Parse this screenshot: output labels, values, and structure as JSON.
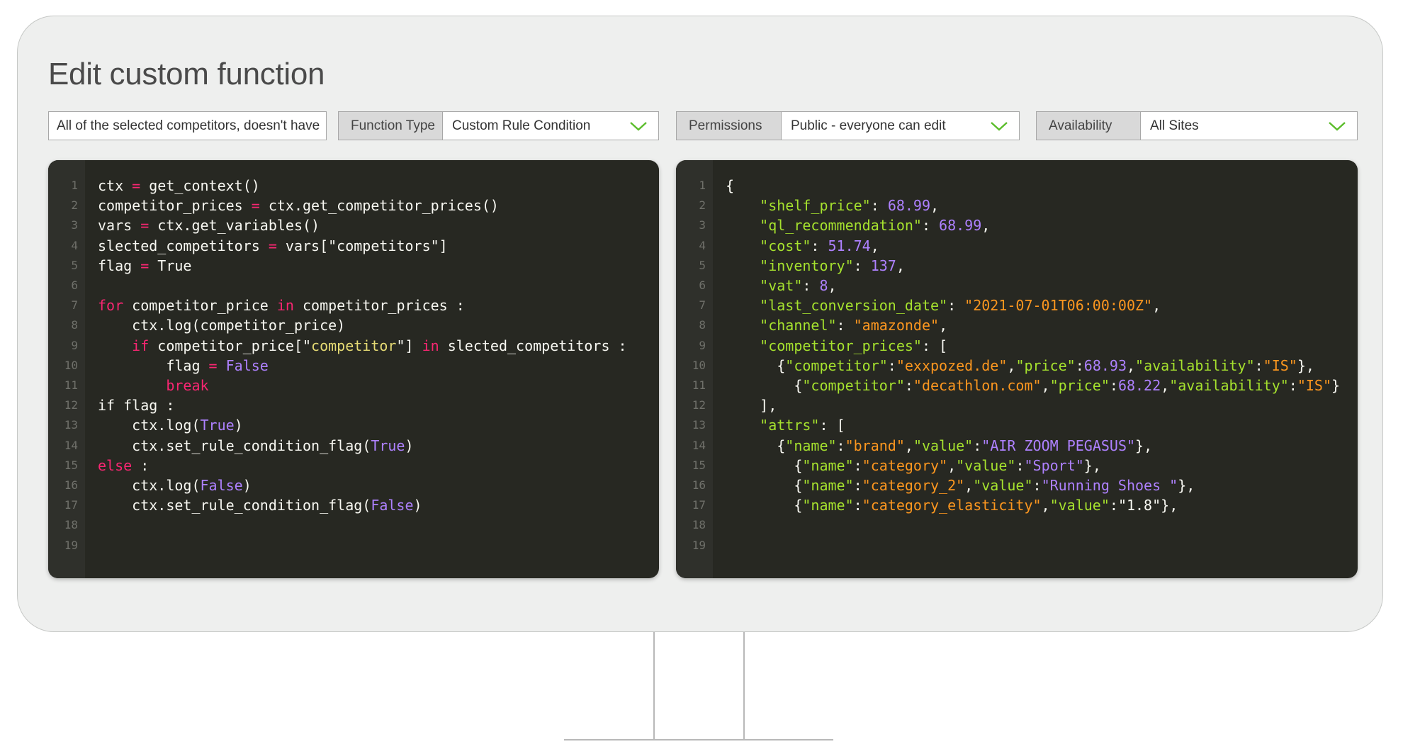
{
  "page_title": "Edit custom function",
  "name_field": {
    "value": "All of the selected competitors, doesn't have"
  },
  "function_type": {
    "label": "Function Type",
    "value": "Custom Rule Condition"
  },
  "permissions": {
    "label": "Permissions",
    "value": "Public - everyone can edit"
  },
  "availability": {
    "label": "Availability",
    "value": "All Sites"
  },
  "colors": {
    "accent_chevron": "#5bbd2b",
    "editor_bg": "#272822"
  },
  "icons": {
    "dropdown": "chevron-down-icon"
  },
  "code_editor": {
    "line_numbers": [
      "1",
      "2",
      "3",
      "4",
      "5",
      "6",
      "7",
      "8",
      "9",
      "10",
      "11",
      "12",
      "13",
      "14",
      "15",
      "16",
      "17",
      "18",
      "19"
    ],
    "lines": [
      {
        "segments": [
          {
            "t": "ctx ",
            "c": ""
          },
          {
            "t": "=",
            "c": "op"
          },
          {
            "t": " get_context()",
            "c": ""
          }
        ]
      },
      {
        "segments": [
          {
            "t": "competitor_prices ",
            "c": ""
          },
          {
            "t": "=",
            "c": "op"
          },
          {
            "t": " ctx.get_competitor_prices()",
            "c": ""
          }
        ]
      },
      {
        "segments": [
          {
            "t": "vars ",
            "c": ""
          },
          {
            "t": "=",
            "c": "op"
          },
          {
            "t": " ctx.get_variables()",
            "c": ""
          }
        ]
      },
      {
        "segments": [
          {
            "t": "slected_competitors ",
            "c": ""
          },
          {
            "t": "=",
            "c": "op"
          },
          {
            "t": " vars[\"competitors\"]",
            "c": ""
          }
        ]
      },
      {
        "segments": [
          {
            "t": "flag ",
            "c": ""
          },
          {
            "t": "=",
            "c": "op"
          },
          {
            "t": " True",
            "c": ""
          }
        ]
      },
      {
        "segments": []
      },
      {
        "segments": [
          {
            "t": "for",
            "c": "kw"
          },
          {
            "t": " competitor_price ",
            "c": ""
          },
          {
            "t": "in",
            "c": "kw"
          },
          {
            "t": " competitor_prices :",
            "c": ""
          }
        ]
      },
      {
        "segments": [
          {
            "t": "    ctx.log(competitor_price)",
            "c": ""
          }
        ]
      },
      {
        "segments": [
          {
            "t": "    ",
            "c": ""
          },
          {
            "t": "if",
            "c": "kw"
          },
          {
            "t": " competitor_price[\"",
            "c": ""
          },
          {
            "t": "competitor",
            "c": "st"
          },
          {
            "t": "\"] ",
            "c": ""
          },
          {
            "t": "in",
            "c": "kw"
          },
          {
            "t": " slected_competitors :",
            "c": ""
          }
        ]
      },
      {
        "segments": [
          {
            "t": "        flag ",
            "c": ""
          },
          {
            "t": "=",
            "c": "op"
          },
          {
            "t": " ",
            "c": ""
          },
          {
            "t": "False",
            "c": "cn"
          }
        ]
      },
      {
        "segments": [
          {
            "t": "        ",
            "c": ""
          },
          {
            "t": "break",
            "c": "kw"
          }
        ]
      },
      {
        "segments": [
          {
            "t": "if flag :",
            "c": ""
          }
        ]
      },
      {
        "segments": [
          {
            "t": "    ctx.log(",
            "c": ""
          },
          {
            "t": "True",
            "c": "cn"
          },
          {
            "t": ")",
            "c": ""
          }
        ]
      },
      {
        "segments": [
          {
            "t": "    ctx.set_rule_condition_flag(",
            "c": ""
          },
          {
            "t": "True",
            "c": "cn"
          },
          {
            "t": ")",
            "c": ""
          }
        ]
      },
      {
        "segments": [
          {
            "t": "else",
            "c": "kw"
          },
          {
            "t": " :",
            "c": ""
          }
        ]
      },
      {
        "segments": [
          {
            "t": "    ctx.log(",
            "c": ""
          },
          {
            "t": "False",
            "c": "cn"
          },
          {
            "t": ")",
            "c": ""
          }
        ]
      },
      {
        "segments": [
          {
            "t": "    ctx.set_rule_condition_flag(",
            "c": ""
          },
          {
            "t": "False",
            "c": "cn"
          },
          {
            "t": ")",
            "c": ""
          }
        ]
      },
      {
        "segments": []
      },
      {
        "segments": []
      }
    ]
  },
  "json_editor": {
    "line_numbers": [
      "1",
      "2",
      "3",
      "4",
      "5",
      "6",
      "7",
      "8",
      "9",
      "10",
      "11",
      "12",
      "13",
      "14",
      "15",
      "16",
      "17",
      "18",
      "19"
    ],
    "lines": [
      {
        "segments": [
          {
            "t": "{",
            "c": ""
          }
        ]
      },
      {
        "segments": [
          {
            "t": "    ",
            "c": ""
          },
          {
            "t": "\"shelf_price\"",
            "c": "ky"
          },
          {
            "t": ": ",
            "c": ""
          },
          {
            "t": "68.99",
            "c": "nm"
          },
          {
            "t": ",",
            "c": ""
          }
        ]
      },
      {
        "segments": [
          {
            "t": "    ",
            "c": ""
          },
          {
            "t": "\"ql_recommendation\"",
            "c": "ky"
          },
          {
            "t": ": ",
            "c": ""
          },
          {
            "t": "68.99",
            "c": "nm"
          },
          {
            "t": ",",
            "c": ""
          }
        ]
      },
      {
        "segments": [
          {
            "t": "    ",
            "c": ""
          },
          {
            "t": "\"cost\"",
            "c": "ky"
          },
          {
            "t": ": ",
            "c": ""
          },
          {
            "t": "51.74",
            "c": "nm"
          },
          {
            "t": ",",
            "c": ""
          }
        ]
      },
      {
        "segments": [
          {
            "t": "    ",
            "c": ""
          },
          {
            "t": "\"inventory\"",
            "c": "ky"
          },
          {
            "t": ": ",
            "c": ""
          },
          {
            "t": "137",
            "c": "nm"
          },
          {
            "t": ",",
            "c": ""
          }
        ]
      },
      {
        "segments": [
          {
            "t": "    ",
            "c": ""
          },
          {
            "t": "\"vat\"",
            "c": "ky"
          },
          {
            "t": ": ",
            "c": ""
          },
          {
            "t": "8",
            "c": "nm"
          },
          {
            "t": ",",
            "c": ""
          }
        ]
      },
      {
        "segments": [
          {
            "t": "    ",
            "c": ""
          },
          {
            "t": "\"last_conversion_date\"",
            "c": "ky"
          },
          {
            "t": ": ",
            "c": ""
          },
          {
            "t": "\"2021-07-01T06:00:00Z\"",
            "c": "sv"
          },
          {
            "t": ",",
            "c": ""
          }
        ]
      },
      {
        "segments": [
          {
            "t": "    ",
            "c": ""
          },
          {
            "t": "\"channel\"",
            "c": "ky"
          },
          {
            "t": ": ",
            "c": ""
          },
          {
            "t": "\"amazonde\"",
            "c": "sv"
          },
          {
            "t": ",",
            "c": ""
          }
        ]
      },
      {
        "segments": [
          {
            "t": "    ",
            "c": ""
          },
          {
            "t": "\"competitor_prices\"",
            "c": "ky"
          },
          {
            "t": ": [",
            "c": ""
          }
        ]
      },
      {
        "segments": [
          {
            "t": "      {",
            "c": ""
          },
          {
            "t": "\"competitor\"",
            "c": "ky"
          },
          {
            "t": ":",
            "c": ""
          },
          {
            "t": "\"exxpozed.de\"",
            "c": "sv"
          },
          {
            "t": ",",
            "c": ""
          },
          {
            "t": "\"price\"",
            "c": "ky"
          },
          {
            "t": ":",
            "c": ""
          },
          {
            "t": "68.93",
            "c": "nm"
          },
          {
            "t": ",",
            "c": ""
          },
          {
            "t": "\"availability\"",
            "c": "ky"
          },
          {
            "t": ":",
            "c": ""
          },
          {
            "t": "\"IS\"",
            "c": "sv"
          },
          {
            "t": "},",
            "c": ""
          }
        ]
      },
      {
        "segments": [
          {
            "t": "        {",
            "c": ""
          },
          {
            "t": "\"competitor\"",
            "c": "ky"
          },
          {
            "t": ":",
            "c": ""
          },
          {
            "t": "\"decathlon.com\"",
            "c": "sv"
          },
          {
            "t": ",",
            "c": ""
          },
          {
            "t": "\"price\"",
            "c": "ky"
          },
          {
            "t": ":",
            "c": ""
          },
          {
            "t": "68.22",
            "c": "nm"
          },
          {
            "t": ",",
            "c": ""
          },
          {
            "t": "\"availability\"",
            "c": "ky"
          },
          {
            "t": ":",
            "c": ""
          },
          {
            "t": "\"IS\"",
            "c": "sv"
          },
          {
            "t": "}",
            "c": ""
          }
        ]
      },
      {
        "segments": [
          {
            "t": "    ],",
            "c": ""
          }
        ]
      },
      {
        "segments": [
          {
            "t": "    ",
            "c": ""
          },
          {
            "t": "\"attrs\"",
            "c": "ky"
          },
          {
            "t": ": [",
            "c": ""
          }
        ]
      },
      {
        "segments": [
          {
            "t": "      {",
            "c": ""
          },
          {
            "t": "\"name\"",
            "c": "ky"
          },
          {
            "t": ":",
            "c": ""
          },
          {
            "t": "\"brand\"",
            "c": "sv"
          },
          {
            "t": ",",
            "c": ""
          },
          {
            "t": "\"value\"",
            "c": "ky"
          },
          {
            "t": ":",
            "c": ""
          },
          {
            "t": "\"AIR ZOOM PEGASUS\"",
            "c": "nm"
          },
          {
            "t": "},",
            "c": ""
          }
        ]
      },
      {
        "segments": [
          {
            "t": "        {",
            "c": ""
          },
          {
            "t": "\"name\"",
            "c": "ky"
          },
          {
            "t": ":",
            "c": ""
          },
          {
            "t": "\"category\"",
            "c": "sv"
          },
          {
            "t": ",",
            "c": ""
          },
          {
            "t": "\"value\"",
            "c": "ky"
          },
          {
            "t": ":",
            "c": ""
          },
          {
            "t": "\"Sport\"",
            "c": "nm"
          },
          {
            "t": "},",
            "c": ""
          }
        ]
      },
      {
        "segments": [
          {
            "t": "        {",
            "c": ""
          },
          {
            "t": "\"name\"",
            "c": "ky"
          },
          {
            "t": ":",
            "c": ""
          },
          {
            "t": "\"category_2\"",
            "c": "sv"
          },
          {
            "t": ",",
            "c": ""
          },
          {
            "t": "\"value\"",
            "c": "ky"
          },
          {
            "t": ":",
            "c": ""
          },
          {
            "t": "\"Running Shoes \"",
            "c": "nm"
          },
          {
            "t": "},",
            "c": ""
          }
        ]
      },
      {
        "segments": [
          {
            "t": "        {",
            "c": ""
          },
          {
            "t": "\"name\"",
            "c": "ky"
          },
          {
            "t": ":",
            "c": ""
          },
          {
            "t": "\"category_elasticity\"",
            "c": "sv"
          },
          {
            "t": ",",
            "c": ""
          },
          {
            "t": "\"value\"",
            "c": "ky"
          },
          {
            "t": ":",
            "c": ""
          },
          {
            "t": "\"1.8\"",
            "c": ""
          },
          {
            "t": "},",
            "c": ""
          }
        ]
      },
      {
        "segments": []
      },
      {
        "segments": []
      }
    ]
  }
}
